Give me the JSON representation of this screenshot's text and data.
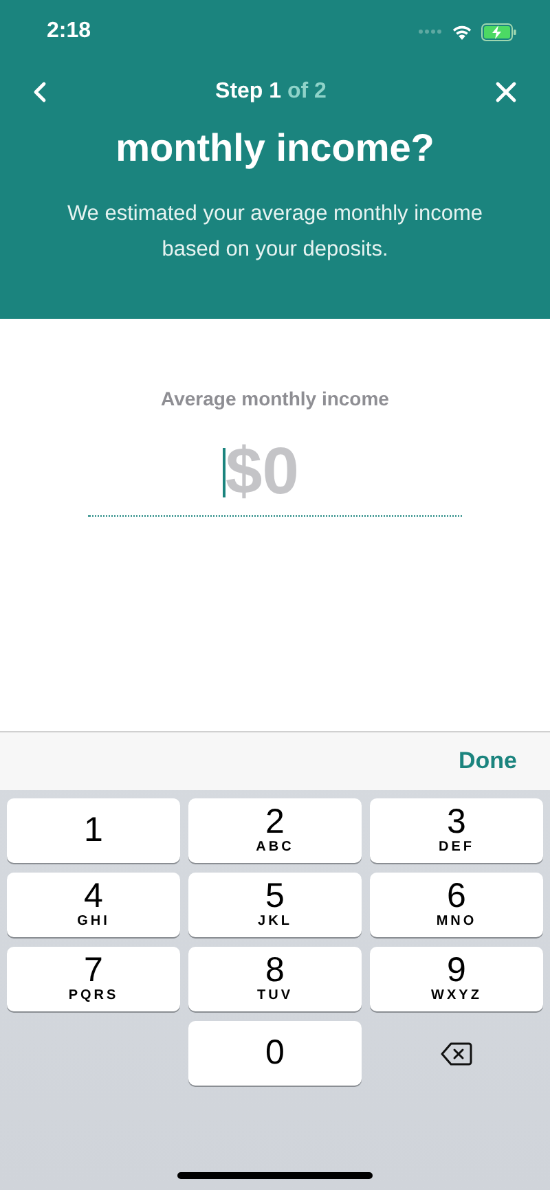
{
  "status_bar": {
    "time": "2:18"
  },
  "header": {
    "step": "Step 1",
    "step_total": "of 2",
    "title": "monthly income?",
    "subtitle": "We estimated your average monthly income based on your deposits."
  },
  "amount": {
    "label": "Average monthly income",
    "placeholder": "$0"
  },
  "toolbar": {
    "done": "Done"
  },
  "keypad": [
    {
      "kind": "digit",
      "digit": "1"
    },
    {
      "kind": "digit",
      "digit": "2",
      "letters": "ABC"
    },
    {
      "kind": "digit",
      "digit": "3",
      "letters": "DEF"
    },
    {
      "kind": "digit",
      "digit": "4",
      "letters": "GHI"
    },
    {
      "kind": "digit",
      "digit": "5",
      "letters": "JKL"
    },
    {
      "kind": "digit",
      "digit": "6",
      "letters": "MNO"
    },
    {
      "kind": "digit",
      "digit": "7",
      "letters": "PQRS"
    },
    {
      "kind": "digit",
      "digit": "8",
      "letters": "TUV"
    },
    {
      "kind": "digit",
      "digit": "9",
      "letters": "WXYZ"
    },
    {
      "kind": "digit",
      "digit": "0"
    },
    {
      "kind": "delete"
    }
  ]
}
